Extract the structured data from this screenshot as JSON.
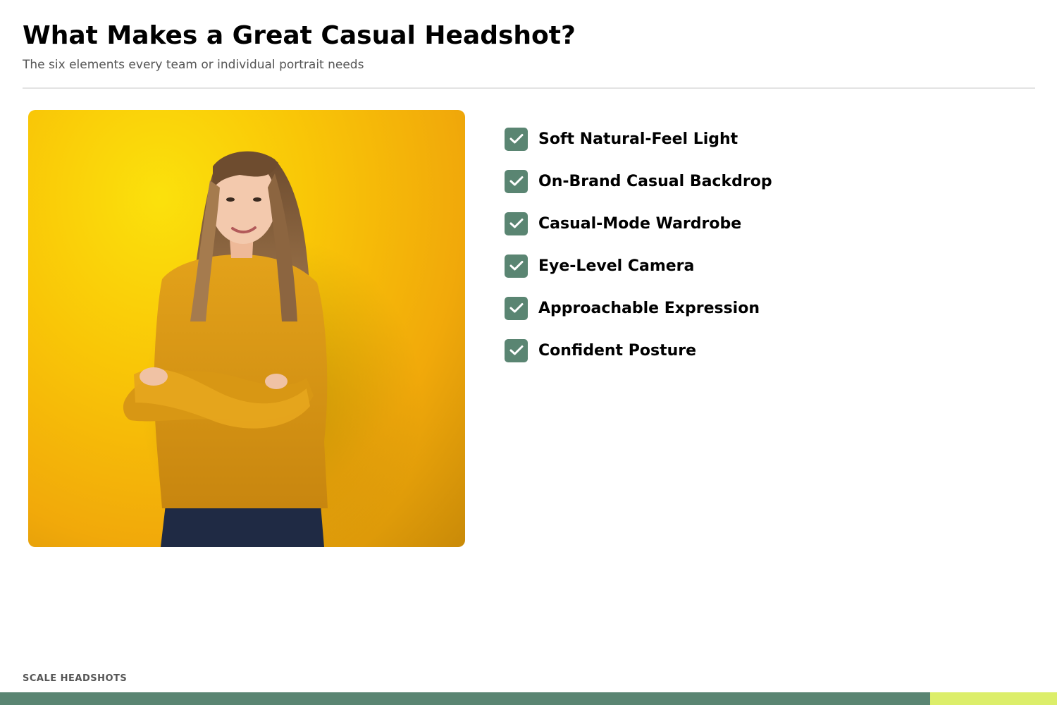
{
  "header": {
    "title": "What Makes a Great Casual Headshot?",
    "subtitle": "The six elements every team or individual portrait needs"
  },
  "photo": {
    "description_icon": "portrait-photo"
  },
  "checklist": {
    "icon": "checkmark-icon",
    "items": [
      {
        "label": "Soft Natural-Feel Light"
      },
      {
        "label": "On-Brand Casual Backdrop"
      },
      {
        "label": "Casual-Mode Wardrobe"
      },
      {
        "label": "Eye-Level Camera"
      },
      {
        "label": "Approachable Expression"
      },
      {
        "label": "Confident Posture"
      }
    ]
  },
  "footer": {
    "brand": "SCALE HEADSHOTS"
  },
  "colors": {
    "accent": "#5a8572",
    "highlight": "#dcee6a",
    "photo_background": "#f9c607"
  }
}
